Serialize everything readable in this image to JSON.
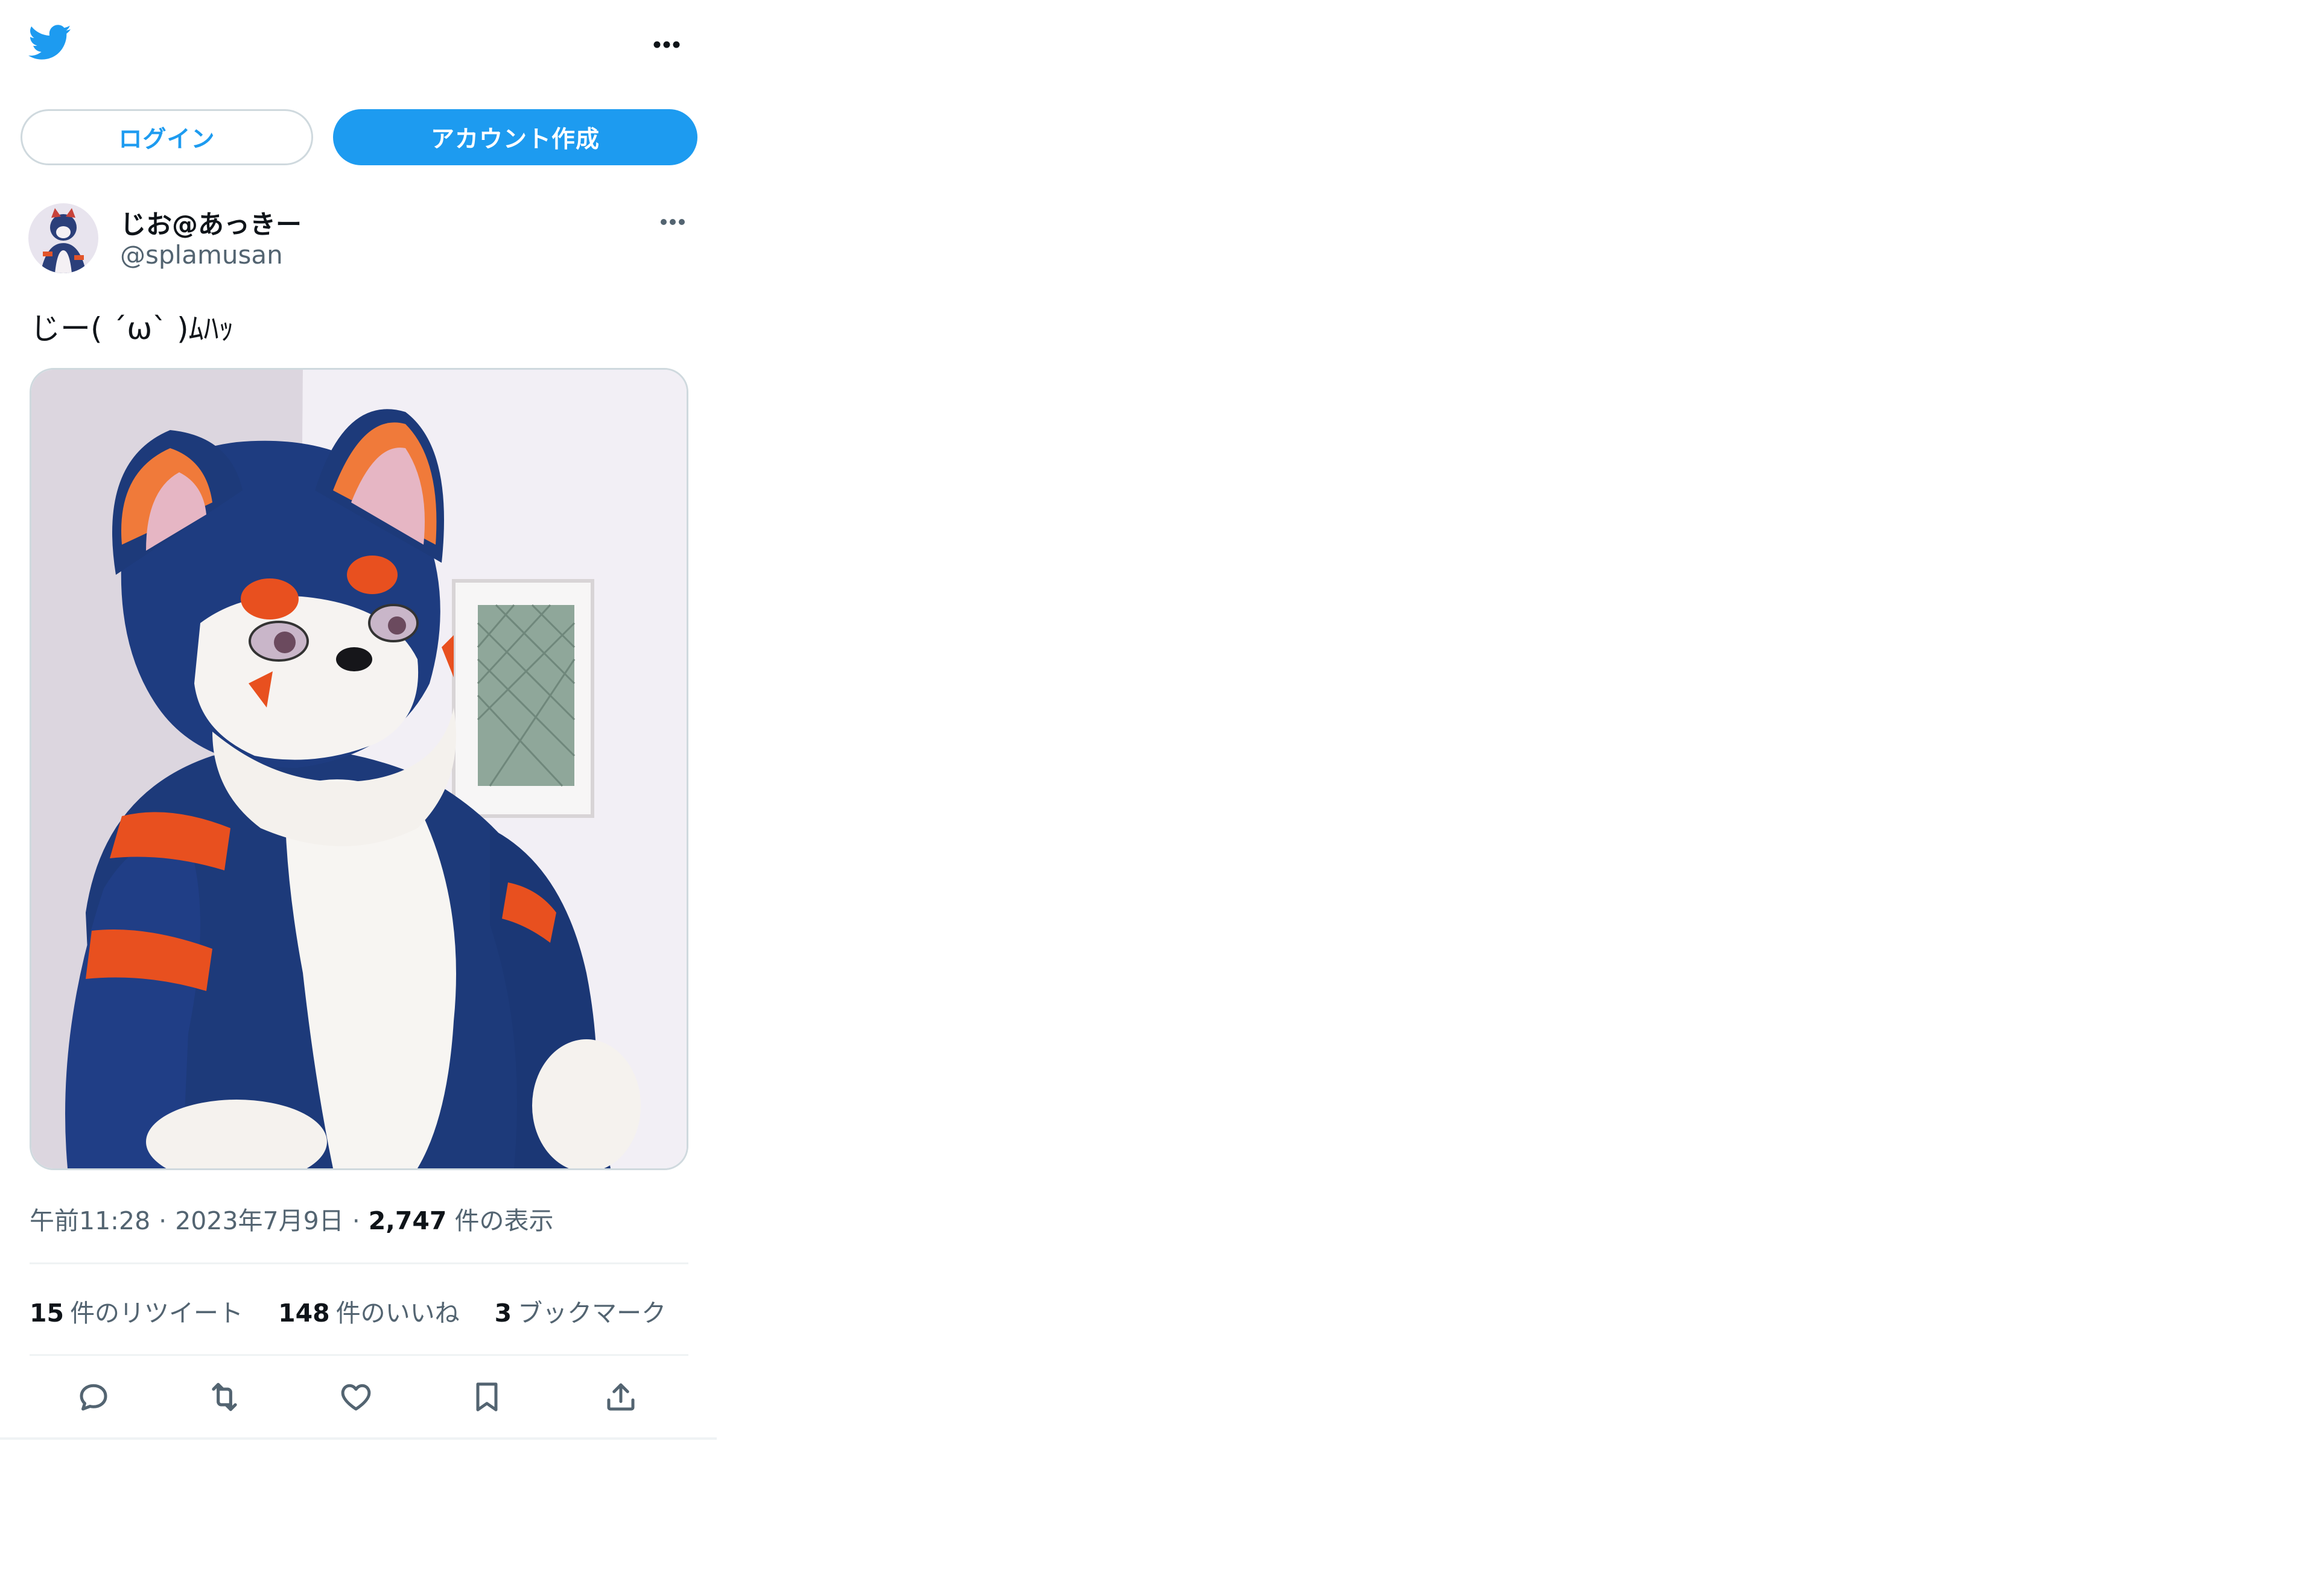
{
  "header": {
    "logo_icon": "twitter-bird-icon",
    "more_icon": "more-horizontal-icon"
  },
  "auth": {
    "login_label": "ログイン",
    "signup_label": "アカウント作成"
  },
  "tweet": {
    "author": {
      "display_name": "じお@あっきー",
      "handle": "@splamusan",
      "avatar_icon": "avatar"
    },
    "text": "じー( ´ω` )ﾑﾊｯ",
    "media": {
      "description_icon": "fursuit-photo"
    },
    "meta": {
      "time": "午前11:28",
      "separator": "·",
      "date": "2023年7月9日",
      "views_count": "2,747",
      "views_label": "件の表示"
    },
    "stats": {
      "retweets_count": "15",
      "retweets_label": "件のリツイート",
      "likes_count": "148",
      "likes_label": "件のいいね",
      "bookmarks_count": "3",
      "bookmarks_label": "ブックマーク"
    },
    "actions": [
      {
        "icon": "reply-icon"
      },
      {
        "icon": "retweet-icon"
      },
      {
        "icon": "like-icon"
      },
      {
        "icon": "bookmark-icon"
      },
      {
        "icon": "share-icon"
      }
    ]
  },
  "colors": {
    "accent": "#1d9bf0",
    "text_primary": "#0f1419",
    "text_secondary": "#536471",
    "border": "#cfd9de",
    "divider": "#eff3f4"
  }
}
